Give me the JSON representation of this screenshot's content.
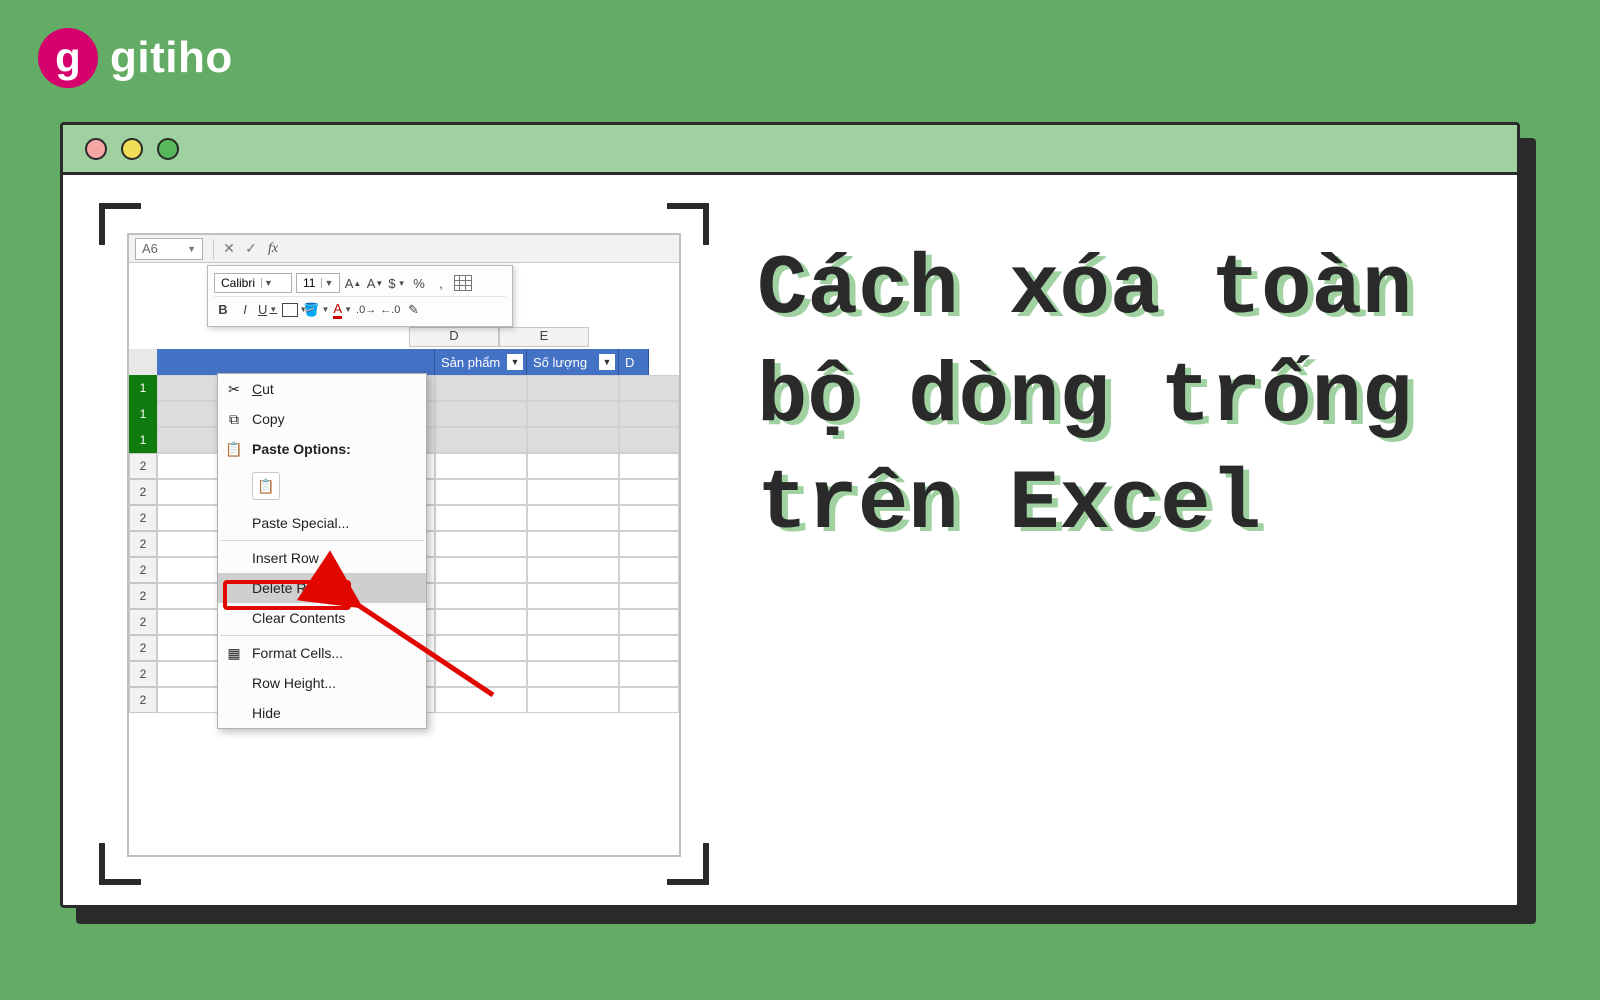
{
  "brand": {
    "name": "gitiho"
  },
  "title": "Cách xóa toàn bộ dòng trống trên Excel",
  "titlebar": {
    "dots": [
      "red",
      "yellow",
      "green"
    ]
  },
  "excel": {
    "name_box": "A6",
    "fx_label": "fx",
    "mini_toolbar": {
      "font": "Calibri",
      "size": "11",
      "buttons_row1": [
        "A↑",
        "A↓",
        "$",
        "%",
        ","
      ],
      "buttons_row2": [
        "B",
        "I",
        "U"
      ]
    },
    "columns": {
      "D": "D",
      "E": "E"
    },
    "headers": {
      "san_pham": "Sản phẩm",
      "so_luong": "Số lượng"
    },
    "context_menu": {
      "cut": "Cut",
      "copy": "Copy",
      "paste_options": "Paste Options:",
      "paste_special": "Paste Special...",
      "insert_row": "Insert Row",
      "delete_row": "Delete Row",
      "clear_contents": "Clear Contents",
      "format_cells": "Format Cells...",
      "row_height": "Row Height...",
      "hide": "Hide"
    },
    "row_numbers_top": [
      "1",
      "1",
      "1"
    ],
    "row_numbers_rest": [
      "2",
      "2",
      "2",
      "2",
      "2",
      "2",
      "2",
      "2",
      "2",
      "2"
    ]
  }
}
